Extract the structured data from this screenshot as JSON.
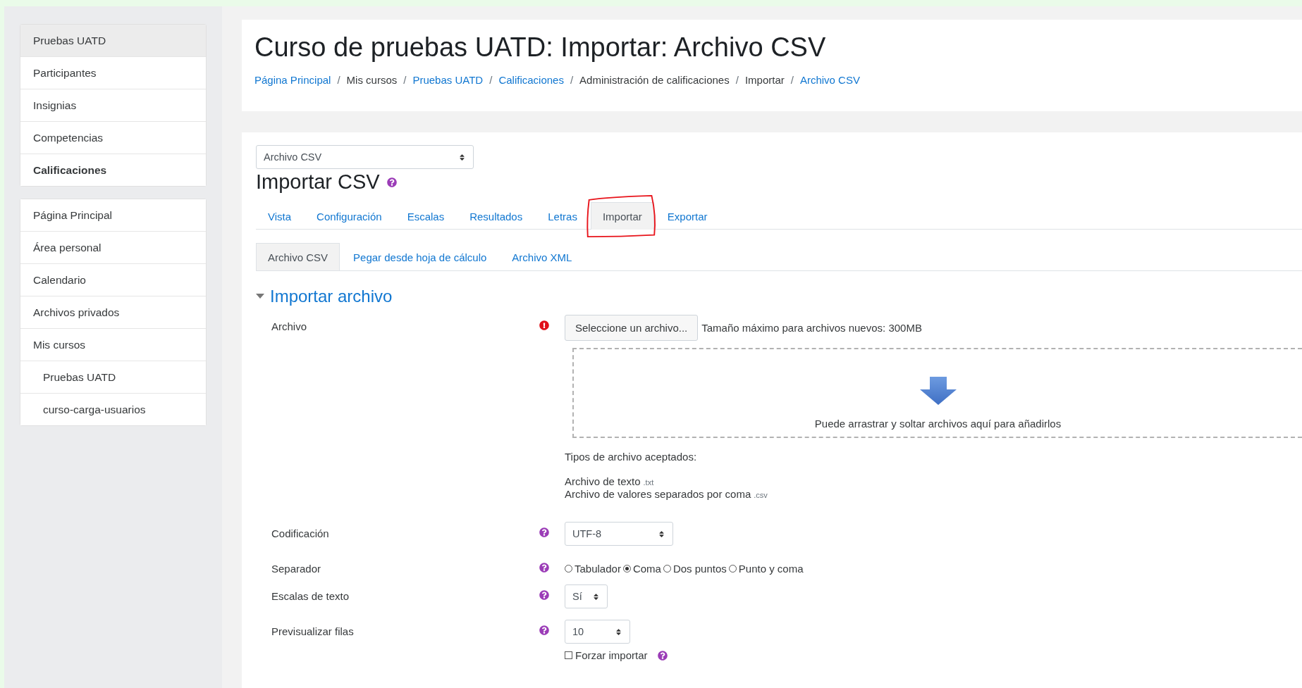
{
  "sidebar": {
    "groups": [
      {
        "items": [
          {
            "label": "Pruebas UATD",
            "selected": true,
            "current": false
          },
          {
            "label": "Participantes",
            "selected": false,
            "current": false
          },
          {
            "label": "Insignias",
            "selected": false,
            "current": false
          },
          {
            "label": "Competencias",
            "selected": false,
            "current": false
          },
          {
            "label": "Calificaciones",
            "selected": false,
            "current": true
          }
        ]
      },
      {
        "items": [
          {
            "label": "Página Principal",
            "selected": false,
            "current": false
          },
          {
            "label": "Área personal",
            "selected": false,
            "current": false
          },
          {
            "label": "Calendario",
            "selected": false,
            "current": false
          },
          {
            "label": "Archivos privados",
            "selected": false,
            "current": false
          },
          {
            "label": "Mis cursos",
            "selected": false,
            "current": false,
            "children": [
              {
                "label": "Pruebas UATD",
                "selected": false,
                "current": false
              },
              {
                "label": "curso-carga-usuarios",
                "selected": false,
                "current": false
              }
            ]
          }
        ]
      }
    ]
  },
  "header": {
    "title": "Curso de pruebas UATD: Importar: Archivo CSV",
    "separator": "/",
    "breadcrumb": [
      {
        "label": "Página Principal",
        "link": true
      },
      {
        "label": "Mis cursos",
        "link": false
      },
      {
        "label": "Pruebas UATD",
        "link": true
      },
      {
        "label": "Calificaciones",
        "link": true
      },
      {
        "label": "Administración de calificaciones",
        "link": false
      },
      {
        "label": "Importar",
        "link": false
      },
      {
        "label": "Archivo CSV",
        "link": true
      }
    ]
  },
  "jump_select": {
    "value": "Archivo CSV"
  },
  "heading": "Importar CSV",
  "tabs": [
    {
      "label": "Vista",
      "selected": false,
      "annotated": false
    },
    {
      "label": "Configuración",
      "selected": false,
      "annotated": false
    },
    {
      "label": "Escalas",
      "selected": false,
      "annotated": false
    },
    {
      "label": "Resultados",
      "selected": false,
      "annotated": false
    },
    {
      "label": "Letras",
      "selected": false,
      "annotated": false
    },
    {
      "label": "Importar",
      "selected": true,
      "annotated": true
    },
    {
      "label": "Exportar",
      "selected": false,
      "annotated": false
    }
  ],
  "subtabs": [
    {
      "label": "Archivo CSV",
      "selected": true
    },
    {
      "label": "Pegar desde hoja de cálculo",
      "selected": false
    },
    {
      "label": "Archivo XML",
      "selected": false
    }
  ],
  "section": {
    "title": "Importar archivo",
    "expanded": true
  },
  "file_field": {
    "label": "Archivo",
    "required": true,
    "button": "Seleccione un archivo...",
    "max_size": "Tamaño máximo para archivos nuevos: 300MB",
    "drop_hint": "Puede arrastrar y soltar archivos aquí para añadirlos",
    "types_title": "Tipos de archivo aceptados:",
    "types": [
      {
        "name": "Archivo de texto",
        "ext": ".txt"
      },
      {
        "name": "Archivo de valores separados por coma",
        "ext": ".csv"
      }
    ]
  },
  "encoding": {
    "label": "Codificación",
    "value": "UTF-8"
  },
  "separator": {
    "label": "Separador",
    "options": [
      {
        "label": "Tabulador",
        "selected": false
      },
      {
        "label": "Coma",
        "selected": true
      },
      {
        "label": "Dos puntos",
        "selected": false
      },
      {
        "label": "Punto y coma",
        "selected": false
      }
    ]
  },
  "text_scales": {
    "label": "Escalas de texto",
    "value": "Sí"
  },
  "preview_rows": {
    "label": "Previsualizar filas",
    "value": "10"
  },
  "force_import": {
    "label": "Forzar importar",
    "checked": false
  }
}
